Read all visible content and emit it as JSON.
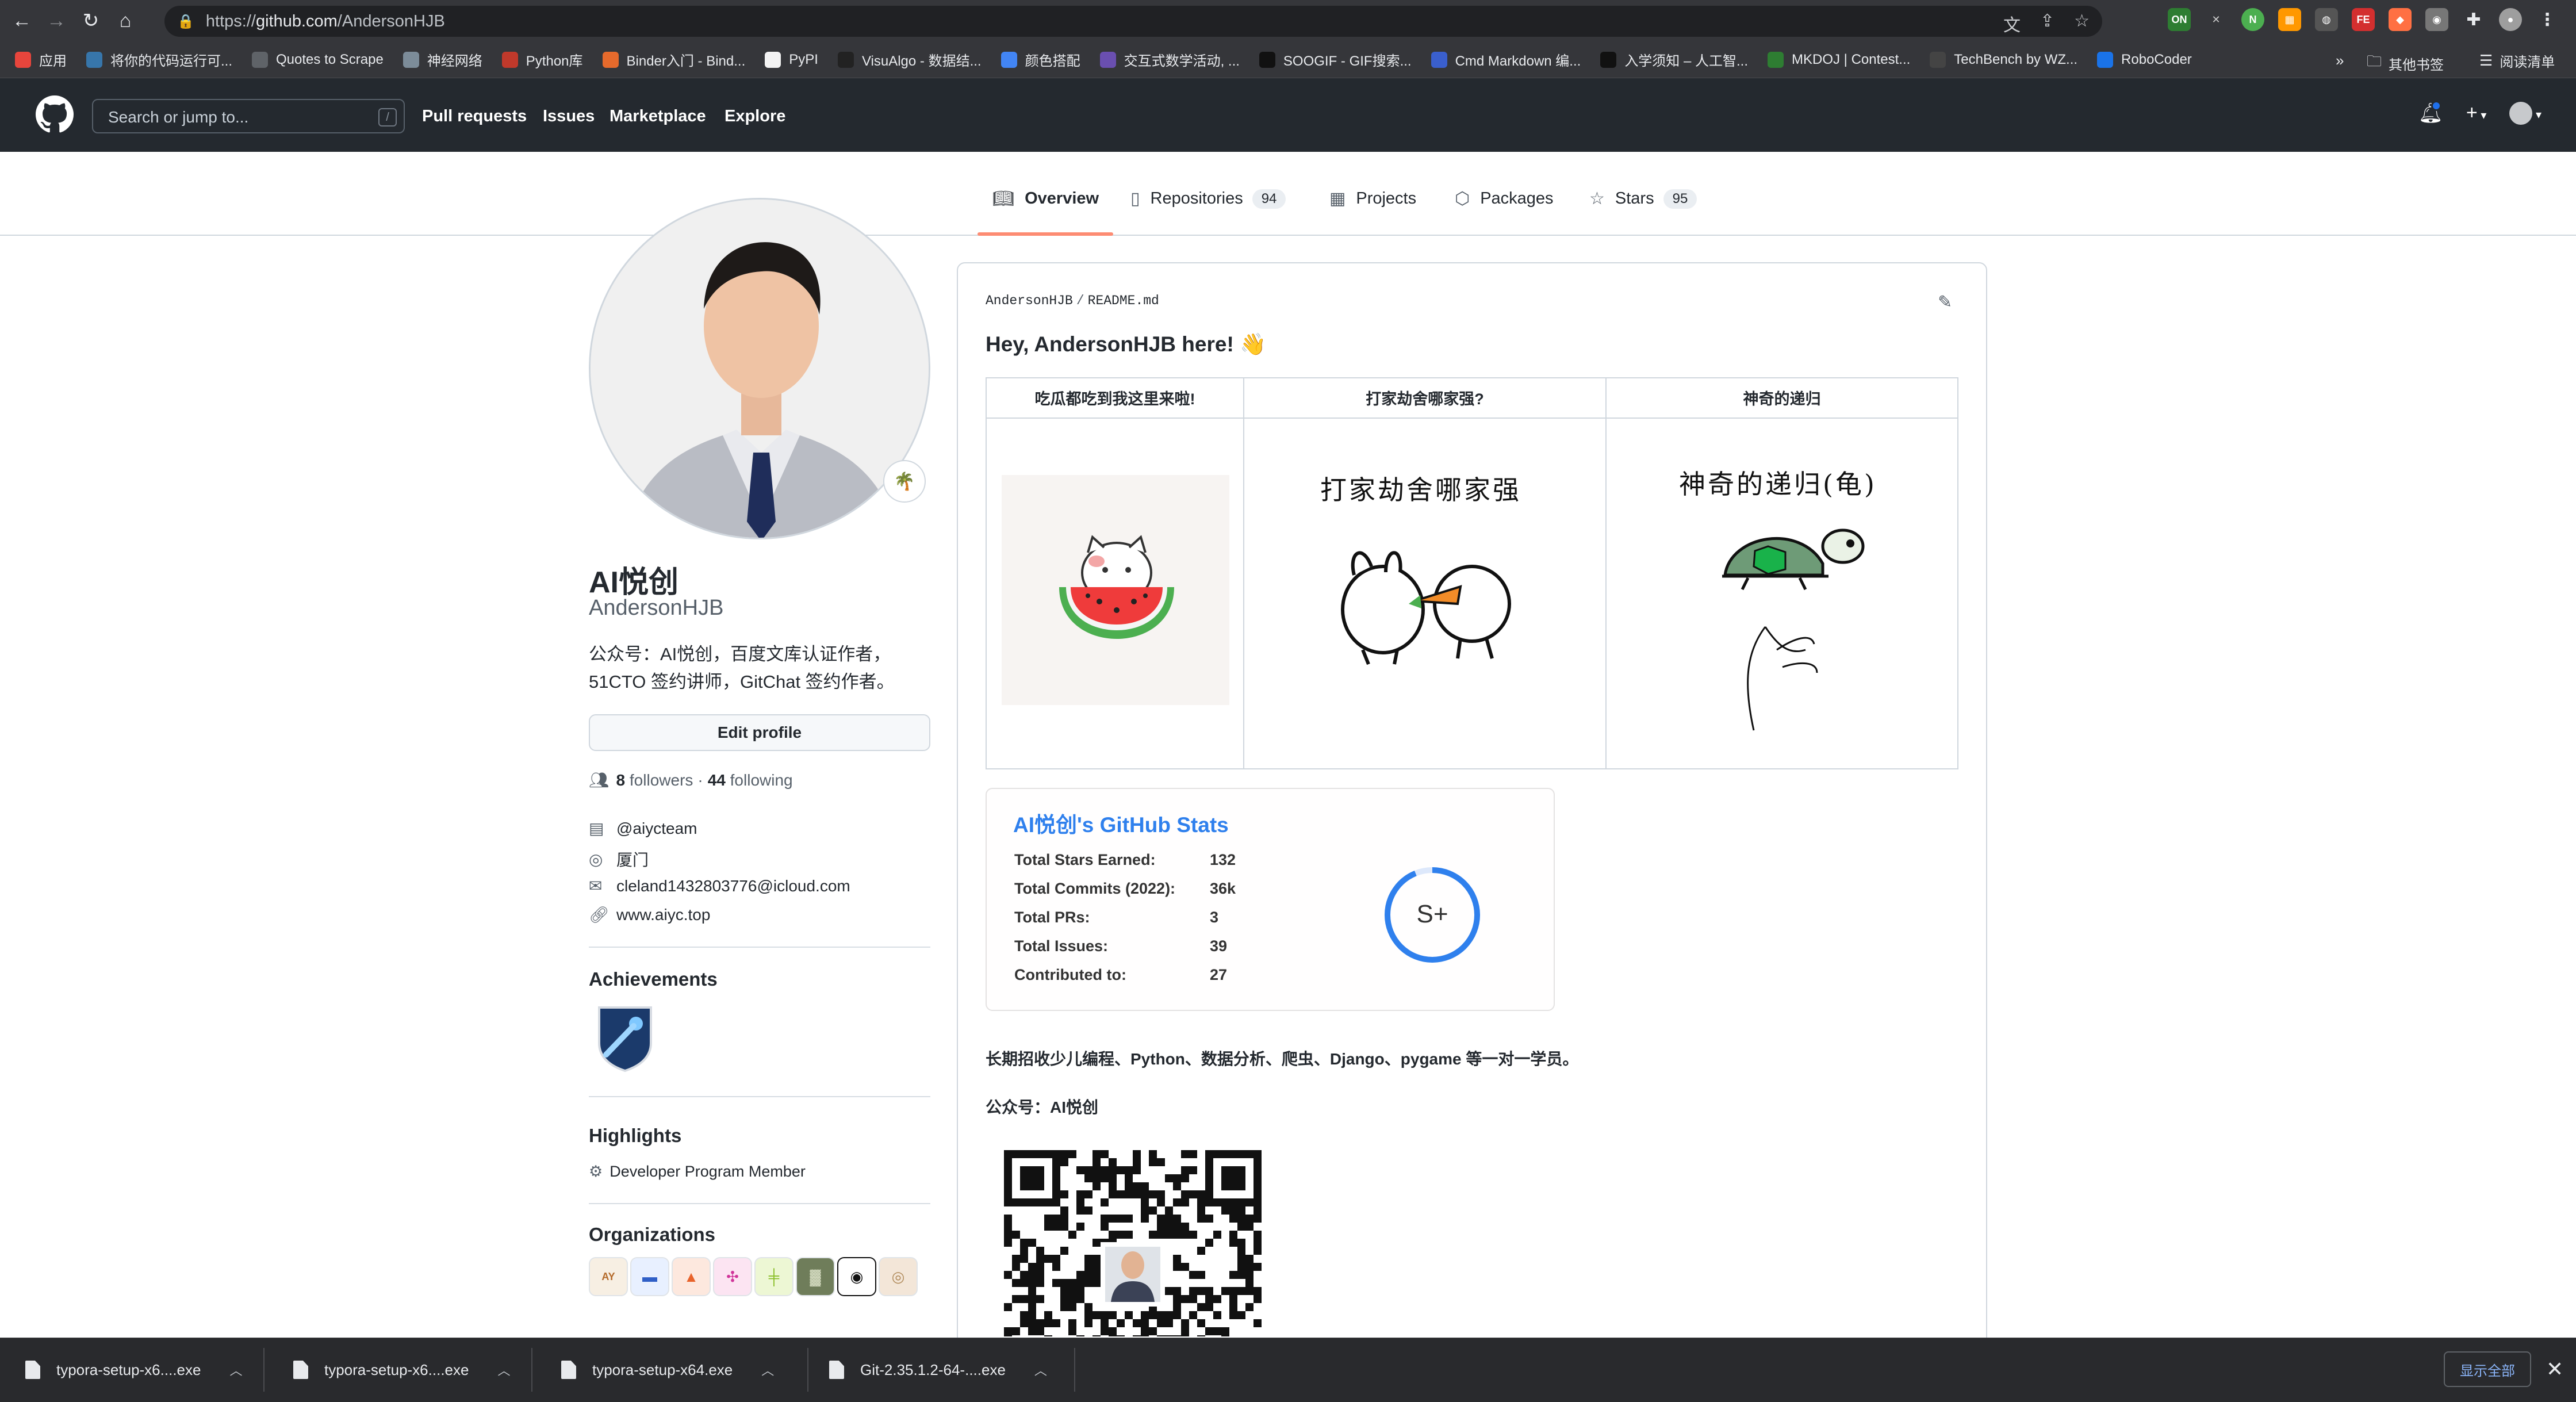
{
  "browser": {
    "url_scheme": "https://",
    "url_host": "github.com",
    "url_path": "/AndersonHJB",
    "bookmarks": [
      {
        "label": "应用",
        "color": "#e8453c"
      },
      {
        "label": "将你的代码运行可...",
        "color": "#3776ab"
      },
      {
        "label": "Quotes to Scrape",
        "color": "#5f6368"
      },
      {
        "label": "神经网络",
        "color": "#7c8c99"
      },
      {
        "label": "Python库",
        "color": "#c0392b"
      },
      {
        "label": "Binder入门 - Bind...",
        "color": "#e66a2c"
      },
      {
        "label": "PyPI",
        "color": "#f3f3f3"
      },
      {
        "label": "VisuAlgo - 数据结...",
        "color": "#222222"
      },
      {
        "label": "颜色搭配",
        "color": "#4285f4"
      },
      {
        "label": "交互式数学活动, ...",
        "color": "#6a4fb0"
      },
      {
        "label": "SOOGIF - GIF搜索...",
        "color": "#111111"
      },
      {
        "label": "Cmd Markdown 编...",
        "color": "#3a5fcd"
      },
      {
        "label": "入学须知 – 人工智...",
        "color": "#111111"
      },
      {
        "label": "MKDOJ | Contest...",
        "color": "#2e7d32"
      },
      {
        "label": "TechBench by WZ...",
        "color": "#444444"
      },
      {
        "label": "RoboCoder",
        "color": "#1a73e8"
      }
    ],
    "overflow": "»",
    "other_bookmarks": "其他书签",
    "reading_list": "阅读清单"
  },
  "gh_header": {
    "search_placeholder": "Search or jump to...",
    "search_shortcut": "/",
    "nav": [
      "Pull requests",
      "Issues",
      "Marketplace",
      "Explore"
    ],
    "new_symbol": "+"
  },
  "tabs": [
    {
      "label": "Overview",
      "icon": "book-icon",
      "counter": ""
    },
    {
      "label": "Repositories",
      "icon": "repo-icon",
      "counter": "94"
    },
    {
      "label": "Projects",
      "icon": "table-icon",
      "counter": ""
    },
    {
      "label": "Packages",
      "icon": "package-icon",
      "counter": ""
    },
    {
      "label": "Stars",
      "icon": "star-icon",
      "counter": "95"
    }
  ],
  "profile": {
    "display_name": "AI悦创",
    "username": "AndersonHJB",
    "bio": "公众号：AI悦创，百度文库认证作者，51CTO 签约讲师，GitChat 签约作者。",
    "edit_label": "Edit profile",
    "followers_count": "8",
    "followers_label": "followers",
    "following_count": "44",
    "following_label": "following",
    "status_emoji": "🌴",
    "org": "@aiycteam",
    "location": "厦门",
    "email": "cleland1432803776@icloud.com",
    "website": "www.aiyc.top",
    "achievements_title": "Achievements",
    "highlights_title": "Highlights",
    "highlight_item": "Developer Program Member",
    "organizations_title": "Organizations"
  },
  "readme": {
    "path_user": "AndersonHJB",
    "path_sep": "/",
    "path_file": "README.md",
    "heading": "Hey, AndersonHJB here! 👋",
    "table_headers": [
      "吃瓜都吃到我这里来啦!",
      "打家劫舍哪家强?",
      "神奇的递归"
    ],
    "meme_caption_2": "打家劫舍哪家强",
    "meme_caption_3": "神奇的递归(龟)",
    "stats": {
      "title": "AI悦创's GitHub Stats",
      "rows": [
        {
          "label": "Total Stars Earned:",
          "value": "132"
        },
        {
          "label": "Total Commits (2022):",
          "value": "36k"
        },
        {
          "label": "Total PRs:",
          "value": "3"
        },
        {
          "label": "Total Issues:",
          "value": "39"
        },
        {
          "label": "Contributed to:",
          "value": "27"
        }
      ],
      "rank": "S+"
    },
    "para1": "长期招收少儿编程、Python、数据分析、爬虫、Django、pygame 等一对一学员。",
    "para2": "公众号：AI悦创"
  },
  "downloads": [
    {
      "name": "typora-setup-x6....exe"
    },
    {
      "name": "typora-setup-x6....exe"
    },
    {
      "name": "typora-setup-x64.exe"
    },
    {
      "name": "Git-2.35.1.2-64-....exe"
    }
  ],
  "downloads_show_all": "显示全部",
  "colors": {
    "accent_blue": "#2f80ed",
    "header_bg": "#24292f",
    "tab_underline": "#fd8c73"
  }
}
